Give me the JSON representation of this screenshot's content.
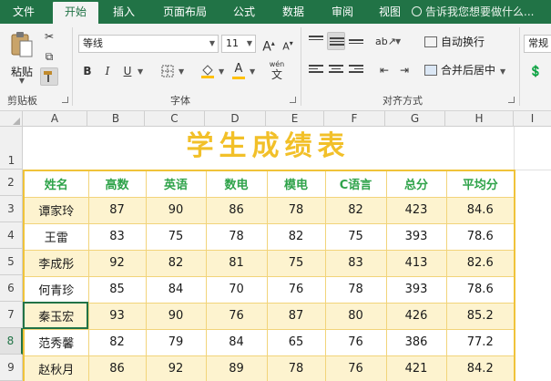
{
  "tabs": [
    "文件",
    "开始",
    "插入",
    "页面布局",
    "公式",
    "数据",
    "审阅",
    "视图"
  ],
  "active_tab": "开始",
  "tell_me": "告诉我您想要做什么...",
  "clipboard": {
    "paste_label": "粘贴",
    "group_label": "剪贴板"
  },
  "font": {
    "name": "等线",
    "size": "11",
    "grow": "A",
    "shrink": "A",
    "bold": "B",
    "italic": "I",
    "underline": "U",
    "group_label": "字体",
    "phonetic": "wén"
  },
  "alignment": {
    "wrap_label": "自动换行",
    "merge_label": "合并后居中",
    "group_label": "对齐方式"
  },
  "number": {
    "format": "常规"
  },
  "columns": [
    "A",
    "B",
    "C",
    "D",
    "E",
    "F",
    "G",
    "H",
    "I"
  ],
  "rows": [
    "1",
    "2",
    "3",
    "4",
    "5",
    "6",
    "7",
    "8",
    "9"
  ],
  "selected_row": "8",
  "sheet": {
    "title": "学生成绩表",
    "headers": [
      "姓名",
      "高数",
      "英语",
      "数电",
      "模电",
      "C语言",
      "总分",
      "平均分"
    ],
    "records": [
      [
        "谭家玲",
        "87",
        "90",
        "86",
        "78",
        "82",
        "423",
        "84.6"
      ],
      [
        "王雷",
        "83",
        "75",
        "78",
        "82",
        "75",
        "393",
        "78.6"
      ],
      [
        "李成彤",
        "92",
        "82",
        "81",
        "75",
        "83",
        "413",
        "82.6"
      ],
      [
        "何青珍",
        "85",
        "84",
        "70",
        "76",
        "78",
        "393",
        "78.6"
      ],
      [
        "秦玉宏",
        "93",
        "90",
        "76",
        "87",
        "80",
        "426",
        "85.2"
      ],
      [
        "范秀馨",
        "82",
        "79",
        "84",
        "65",
        "76",
        "386",
        "77.2"
      ],
      [
        "赵秋月",
        "86",
        "92",
        "89",
        "78",
        "76",
        "421",
        "84.2"
      ]
    ]
  },
  "colors": {
    "brand": "#217346",
    "title": "#f2c029",
    "header_text": "#2fa34a",
    "band_fill": "#fdf3cf",
    "table_border": "#f0c33a"
  }
}
